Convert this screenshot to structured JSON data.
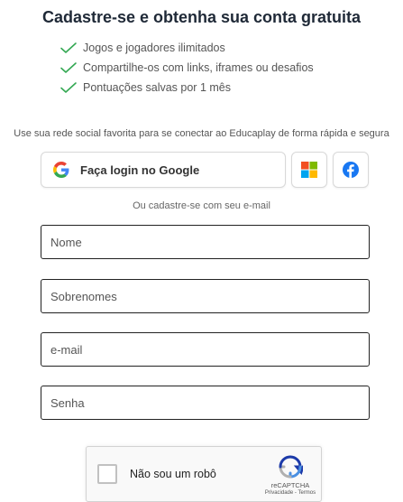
{
  "header": {
    "title": "Cadastre-se e obtenha sua conta gratuita"
  },
  "benefits": [
    "Jogos e jogadores ilimitados",
    "Compartilhe-os com links, iframes ou desafios",
    "Pontuações salvas por 1 mês"
  ],
  "social": {
    "hint": "Use sua rede social favorita para se conectar ao Educaplay de forma rápida e segura",
    "google_label": "Faça login no Google"
  },
  "email_hint": "Ou cadastre-se com seu e-mail",
  "form": {
    "name_placeholder": "Nome",
    "surname_placeholder": "Sobrenomes",
    "email_placeholder": "e-mail",
    "password_placeholder": "Senha"
  },
  "captcha": {
    "label": "Não sou um robô",
    "brand": "reCAPTCHA",
    "links": "Privacidade - Termos"
  },
  "colors": {
    "check_green": "#34a853",
    "facebook_blue": "#1877f2",
    "title_text": "#1f2937"
  },
  "icons": {
    "check": "check-icon",
    "google": "google-icon",
    "microsoft": "microsoft-icon",
    "facebook": "facebook-icon",
    "recaptcha": "recaptcha-icon"
  }
}
